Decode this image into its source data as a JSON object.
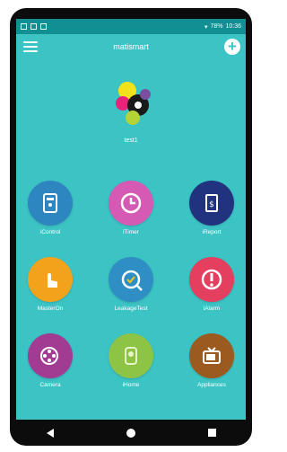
{
  "status_bar": {
    "left_icons": [
      "sim-icon",
      "signal-icon",
      "photo-icon"
    ],
    "right_text": "78%",
    "time": "10:36"
  },
  "app_bar": {
    "title": "matismart",
    "menu_icon": "hamburger-icon",
    "add_icon": "plus-circle-icon"
  },
  "user": {
    "name": "test1"
  },
  "tiles": [
    {
      "label": "iControl",
      "color": "#2e86c1",
      "icon": "remote-icon"
    },
    {
      "label": "iTimer",
      "color": "#d45ab3",
      "icon": "clock-icon"
    },
    {
      "label": "iReport",
      "color": "#21337e",
      "icon": "report-icon"
    },
    {
      "label": "MasterOn",
      "color": "#f3a21b",
      "icon": "hand-touch-icon"
    },
    {
      "label": "LeakageTest",
      "color": "#2f8fc4",
      "icon": "leakage-meter-icon"
    },
    {
      "label": "iAlarm",
      "color": "#e43f5e",
      "icon": "alarm-icon"
    },
    {
      "label": "Camera",
      "color": "#a23c93",
      "icon": "camera-reel-icon"
    },
    {
      "label": "iHome",
      "color": "#8ec445",
      "icon": "home-icon"
    },
    {
      "label": "Appliances",
      "color": "#9b5a1f",
      "icon": "tv-icon"
    }
  ],
  "nav_bar": {
    "back": "back-icon",
    "home": "home-circle-icon",
    "recent": "recent-apps-icon"
  }
}
